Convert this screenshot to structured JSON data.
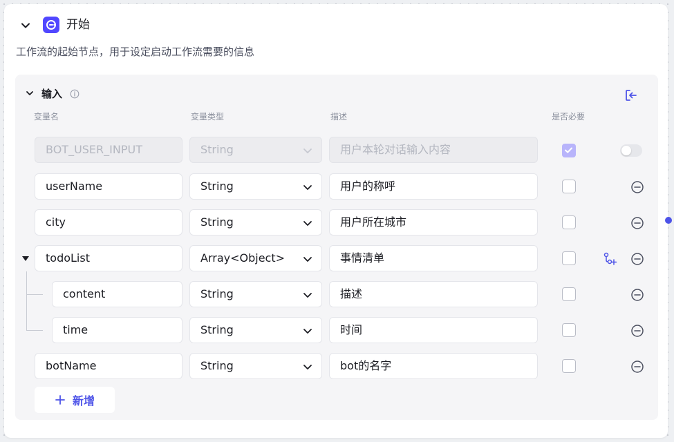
{
  "node": {
    "title": "开始",
    "description": "工作流的起始节点，用于设定启动工作流需要的信息",
    "icon": "start-node-icon",
    "accent_color": "#5147ff"
  },
  "input_section": {
    "title": "输入",
    "columns": {
      "name": "变量名",
      "type": "变量类型",
      "description": "描述",
      "required": "是否必要"
    },
    "rows": [
      {
        "name": "BOT_USER_INPUT",
        "type": "String",
        "description": "用户本轮对话输入内容",
        "required": true,
        "disabled": true,
        "toggle_on": false
      },
      {
        "name": "userName",
        "type": "String",
        "description": "用户的称呼",
        "required": false
      },
      {
        "name": "city",
        "type": "String",
        "description": "用户所在城市",
        "required": false
      },
      {
        "name": "todoList",
        "type": "Array<Object>",
        "description": "事情清单",
        "required": false,
        "expanded": true
      },
      {
        "name": "content",
        "type": "String",
        "description": "描述",
        "required": false,
        "child": true
      },
      {
        "name": "time",
        "type": "String",
        "description": "时间",
        "required": false,
        "child": true
      },
      {
        "name": "botName",
        "type": "String",
        "description": "bot的名字",
        "required": false
      }
    ],
    "add_button_label": "新增"
  },
  "colors": {
    "primary": "#4d53e8",
    "panel_bg": "#f5f5f7",
    "disabled_check": "#b8b4fb"
  }
}
